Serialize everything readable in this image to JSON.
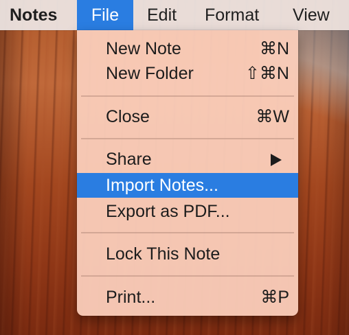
{
  "menubar": {
    "app_name": "Notes",
    "menus": [
      "File",
      "Edit",
      "Format",
      "View"
    ],
    "active_menu": "File"
  },
  "file_menu": {
    "items": [
      {
        "label": "New Note",
        "shortcut": "⌘N"
      },
      {
        "label": "New Folder",
        "shortcut": "⇧⌘N"
      },
      {
        "label": "Close",
        "shortcut": "⌘W"
      },
      {
        "label": "Share",
        "submenu": true
      },
      {
        "label": "Import Notes...",
        "highlighted": true
      },
      {
        "label": "Export as PDF..."
      },
      {
        "label": "Lock This Note"
      },
      {
        "label": "Print...",
        "shortcut": "⌘P"
      }
    ]
  },
  "colors": {
    "highlight": "#2a7de1",
    "menu_background": "#facebb",
    "menubar_background": "#ece4e2"
  }
}
